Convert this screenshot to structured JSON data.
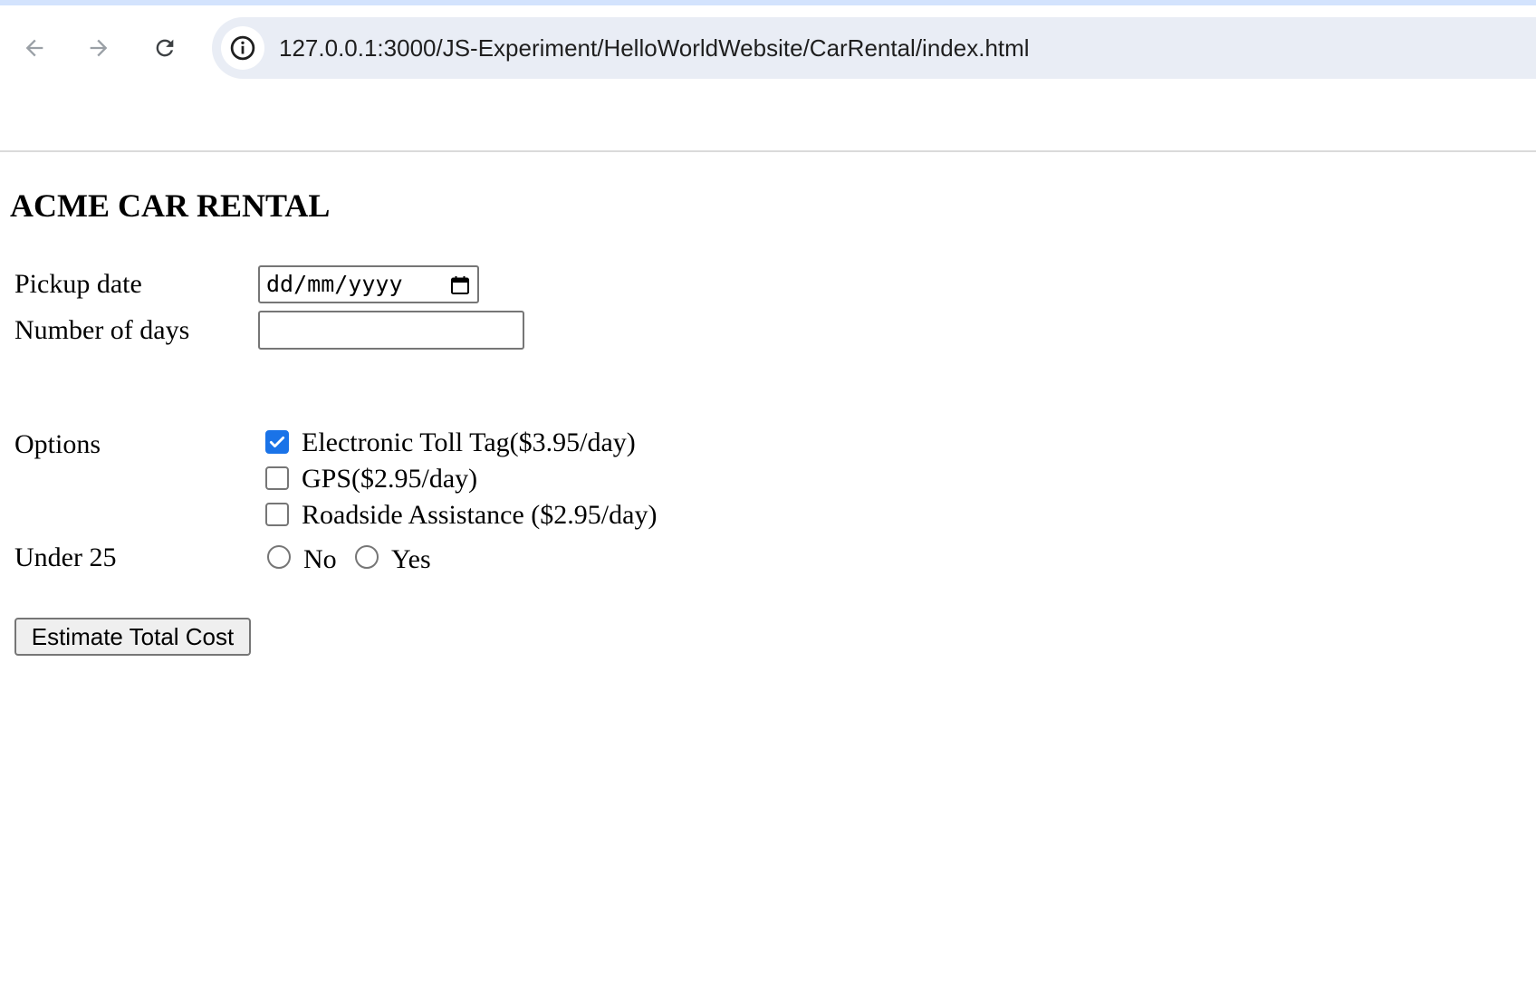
{
  "browser": {
    "url": "127.0.0.1:3000/JS-Experiment/HelloWorldWebsite/CarRental/index.html",
    "back_icon": "arrow-left-icon",
    "forward_icon": "arrow-right-icon",
    "reload_icon": "reload-icon",
    "site_info_icon": "info-icon"
  },
  "page": {
    "title": "ACME CAR RENTAL",
    "pickup_label": "Pickup date",
    "pickup_placeholder": "dd/mm/yyyy",
    "calendar_icon": "calendar-icon",
    "days_label": "Number of days",
    "days_value": "",
    "options_label": "Options",
    "options": [
      {
        "label": "Electronic Toll Tag($3.95/day)",
        "checked": true
      },
      {
        "label": "GPS($2.95/day)",
        "checked": false
      },
      {
        "label": "Roadside Assistance ($2.95/day)",
        "checked": false
      }
    ],
    "under25_label": "Under 25",
    "under25_choices": [
      {
        "label": "No",
        "selected": false
      },
      {
        "label": "Yes",
        "selected": false
      }
    ],
    "estimate_button": "Estimate Total Cost"
  },
  "colors": {
    "accent": "#1a73e8",
    "omnibox_bg": "#e9edf5",
    "top_strip": "#d3e3fd"
  }
}
